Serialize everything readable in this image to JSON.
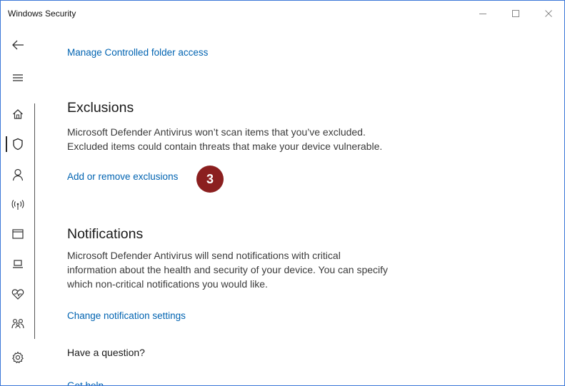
{
  "window": {
    "title": "Windows Security",
    "controls": [
      "minimize",
      "maximize",
      "close"
    ],
    "accent_border": "#3c78d8"
  },
  "nav": {
    "back_icon": "back-arrow-icon",
    "menu_icon": "hamburger-menu-icon",
    "items": [
      {
        "icon": "home-icon"
      },
      {
        "icon": "shield-icon",
        "active": true
      },
      {
        "icon": "account-icon"
      },
      {
        "icon": "firewall-network-icon"
      },
      {
        "icon": "app-browser-icon"
      },
      {
        "icon": "device-security-icon"
      },
      {
        "icon": "device-health-icon"
      },
      {
        "icon": "family-options-icon"
      }
    ],
    "settings_icon": "gear-icon"
  },
  "content": {
    "controlled_folder_link": "Manage Controlled folder access",
    "exclusions": {
      "heading": "Exclusions",
      "description_line1": "Microsoft Defender Antivirus won’t scan items that you’ve excluded.",
      "description_line2": "Excluded items could contain threats that make your device vulnerable.",
      "link": "Add or remove exclusions",
      "callout_number": "3"
    },
    "notifications": {
      "heading": "Notifications",
      "description_line1": "Microsoft Defender Antivirus will send notifications with critical",
      "description_line2": "information about the health and security of your device. You can specify",
      "description_line3": "which non-critical notifications you would like.",
      "link": "Change notification settings"
    },
    "question": {
      "heading": "Have a question?",
      "link": "Get help"
    }
  },
  "colors": {
    "link": "#0063b1",
    "callout": "#8b1f1f",
    "text": "#3b3b3b"
  }
}
